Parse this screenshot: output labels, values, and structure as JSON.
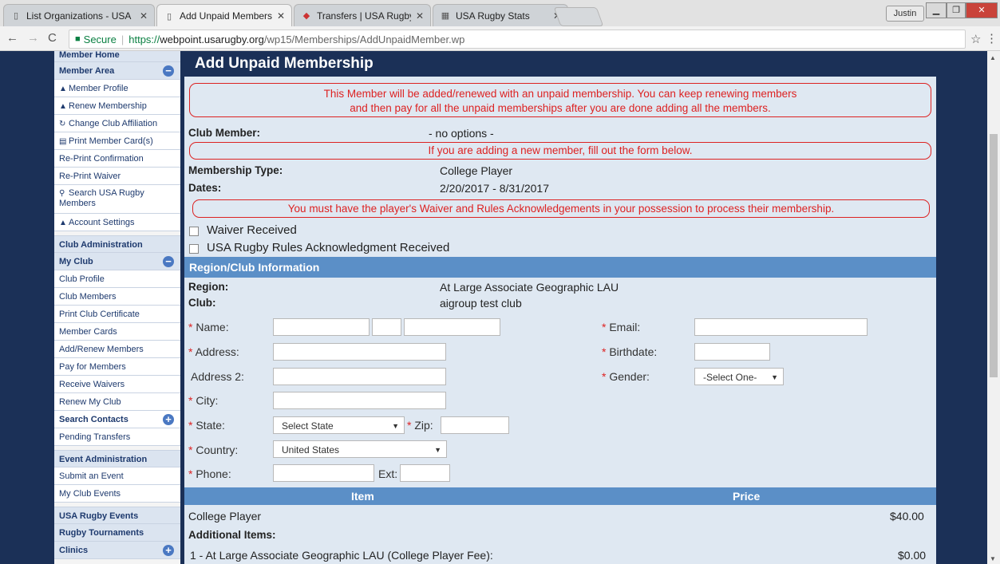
{
  "browser": {
    "tabs": [
      {
        "label": "List Organizations - USA",
        "active": false
      },
      {
        "label": "Add Unpaid Membership",
        "active": true
      },
      {
        "label": "Transfers | USA Rugby M",
        "active": false
      },
      {
        "label": "USA Rugby Stats",
        "active": false
      }
    ],
    "user": "Justin",
    "secure_label": "Secure",
    "url_scheme": "https://",
    "url_host": "webpoint.usarugby.org",
    "url_path": "/wp15/Memberships/AddUnpaidMember.wp"
  },
  "sidebar": {
    "items": [
      {
        "label": "Member Home",
        "type": "header"
      },
      {
        "label": "Member Area",
        "type": "header",
        "toggle": "−"
      },
      {
        "label": "Member Profile",
        "icon": "user"
      },
      {
        "label": "Renew Membership",
        "icon": "user-plus"
      },
      {
        "label": "Change Club Affiliation",
        "icon": "refresh"
      },
      {
        "label": "Print Member Card(s)",
        "icon": "card"
      },
      {
        "label": "Re-Print Confirmation"
      },
      {
        "label": "Re-Print Waiver"
      },
      {
        "label": "Search USA Rugby Members",
        "icon": "search",
        "tall": true
      },
      {
        "label": "Account Settings",
        "icon": "user"
      },
      {
        "label": "Club Administration",
        "type": "header",
        "gap": true
      },
      {
        "label": "My Club",
        "type": "header",
        "toggle": "−"
      },
      {
        "label": "Club Profile"
      },
      {
        "label": "Club Members"
      },
      {
        "label": "Print Club Certificate"
      },
      {
        "label": "Member Cards"
      },
      {
        "label": "Add/Renew Members"
      },
      {
        "label": "Pay for Members"
      },
      {
        "label": "Receive Waivers"
      },
      {
        "label": "Renew My Club"
      },
      {
        "label": "Search Contacts",
        "type": "bold",
        "toggle": "+"
      },
      {
        "label": "Pending Transfers"
      },
      {
        "label": "Event Administration",
        "type": "header",
        "gap": true
      },
      {
        "label": "Submit an Event"
      },
      {
        "label": "My Club Events"
      },
      {
        "label": "USA Rugby Events",
        "type": "header",
        "gap": true
      },
      {
        "label": "Rugby Tournaments",
        "type": "header"
      },
      {
        "label": "Clinics",
        "type": "header",
        "toggle": "+"
      }
    ]
  },
  "main": {
    "title": "Add Unpaid Membership",
    "notice_unpaid_1": "This Member will be added/renewed with an unpaid membership. You can keep renewing members",
    "notice_unpaid_2": "and then pay for all the unpaid memberships after you are done adding all the members.",
    "club_member_label": "Club Member:",
    "club_member_value": "- no options -",
    "notice_new_member": "If you are adding a new member, fill out the form below.",
    "membership_type_label": "Membership Type:",
    "membership_type_value": "College Player",
    "dates_label": "Dates:",
    "dates_value": "2/20/2017 - 8/31/2017",
    "notice_waiver": "You must have the player's Waiver and Rules Acknowledgements in your possession to process their membership.",
    "waiver_received": "Waiver Received",
    "rules_received": "USA Rugby Rules Acknowledgment Received",
    "region_section": "Region/Club Information",
    "region_label": "Region:",
    "region_value": "At Large Associate Geographic LAU",
    "club_label": "Club:",
    "club_value": "aigroup test club",
    "form": {
      "name_label": "Name:",
      "address_label": "Address:",
      "address2_label": "Address 2:",
      "city_label": "City:",
      "state_label": "State:",
      "state_value": "Select State",
      "zip_label": "Zip:",
      "country_label": "Country:",
      "country_value": "United States",
      "phone_label": "Phone:",
      "ext_label": "Ext:",
      "email_label": "Email:",
      "birthdate_label": "Birthdate:",
      "gender_label": "Gender:",
      "gender_value": "-Select One-",
      "required_mark": "*"
    },
    "items_table": {
      "item_header": "Item",
      "price_header": "Price",
      "row1_item": "College Player",
      "row1_price": "$40.00",
      "additional_label": "Additional Items:",
      "row2_item": "1 - At Large Associate Geographic LAU (College Player Fee):",
      "row2_price": "$0.00"
    }
  },
  "colors": {
    "navy": "#1b3057",
    "section_blue": "#5b8fc7",
    "form_bg": "#dfe8f2",
    "notice_red": "#dd2222"
  }
}
